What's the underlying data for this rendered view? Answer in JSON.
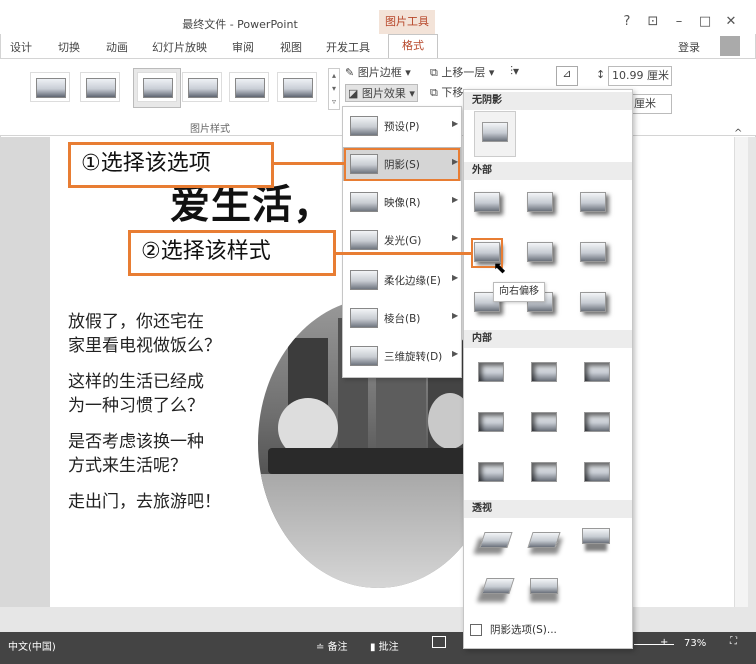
{
  "window": {
    "title": "最终文件 - PowerPoint",
    "context_group": "图片工具",
    "help": "?",
    "restore_ribbon": "⊡",
    "minimize": "–",
    "maximize": "□",
    "close": "✕"
  },
  "tabs": [
    {
      "label": "设计"
    },
    {
      "label": "切换"
    },
    {
      "label": "动画"
    },
    {
      "label": "幻灯片放映"
    },
    {
      "label": "审阅"
    },
    {
      "label": "视图"
    },
    {
      "label": "开发工具"
    },
    {
      "label": "格式"
    }
  ],
  "login": "登录",
  "ribbon": {
    "picture_border": "图片边框 ▾",
    "picture_effects": "图片效果 ▾",
    "bring_forward": "上移一层 ▾",
    "send_backward": "下移",
    "height_value": "10.99 厘米",
    "width_value": "厘米",
    "group_label": "图片样式"
  },
  "slide": {
    "title": "爱生活，",
    "lines": [
      "放假了，你还宅在",
      "家里看电视做饭么？",
      "这样的生活已经成",
      "为一种习惯了么？",
      "是否考虑该换一种",
      "方式来生活呢？",
      "走出门，去旅游吧！"
    ]
  },
  "effects_menu": [
    {
      "label": "预设(P)"
    },
    {
      "label": "阴影(S)"
    },
    {
      "label": "映像(R)"
    },
    {
      "label": "发光(G)"
    },
    {
      "label": "柔化边缘(E)"
    },
    {
      "label": "棱台(B)"
    },
    {
      "label": "三维旋转(D)"
    }
  ],
  "shadow_gallery": {
    "sections": {
      "none": "无阴影",
      "outer": "外部",
      "inner": "内部",
      "perspective": "透视"
    },
    "tooltip": "向右偏移",
    "options_link": "阴影选项(S)..."
  },
  "callouts": {
    "step1": "①选择该选项",
    "step2": "②选择该样式"
  },
  "status": {
    "language": "中文(中国)",
    "notes": "≐ 备注",
    "comments": "▮ 批注",
    "zoom": "73%"
  },
  "colors": {
    "accent": "#e87d33",
    "context_tab": "#b7472a",
    "statusbar": "#444444"
  }
}
